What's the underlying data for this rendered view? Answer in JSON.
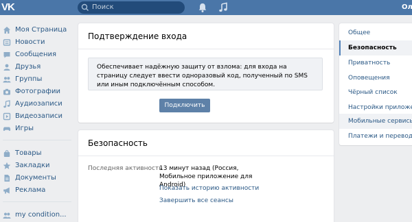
{
  "header": {
    "logo": "VK",
    "search_placeholder": "Поиск",
    "user_name": "Ол"
  },
  "leftnav": {
    "items": [
      {
        "label": "Моя Страница",
        "icon": "home-icon"
      },
      {
        "label": "Новости",
        "icon": "news-icon"
      },
      {
        "label": "Сообщения",
        "icon": "messages-icon"
      },
      {
        "label": "Друзья",
        "icon": "friends-icon"
      },
      {
        "label": "Группы",
        "icon": "groups-icon"
      },
      {
        "label": "Фотографии",
        "icon": "camera-icon"
      },
      {
        "label": "Аудиозаписи",
        "icon": "music-icon"
      },
      {
        "label": "Видеозаписи",
        "icon": "video-icon"
      },
      {
        "label": "Игры",
        "icon": "gamepad-icon"
      },
      {
        "label": "Товары",
        "icon": "bag-icon"
      },
      {
        "label": "Закладки",
        "icon": "star-icon"
      },
      {
        "label": "Документы",
        "icon": "document-icon"
      },
      {
        "label": "Реклама",
        "icon": "megaphone-icon"
      },
      {
        "label": "my condition...",
        "icon": "group-avatar-icon"
      }
    ]
  },
  "login_confirm": {
    "title": "Подтверждение входа",
    "notice": "Обеспечивает надёжную защиту от взлома: для входа на страницу следует ввести одноразовый код, полученный по SMS или иным подключённым способом.",
    "button": "Подключить"
  },
  "security": {
    "title": "Безопасность",
    "last_activity_label": "Последняя активность",
    "last_activity_value": "13 минут назад (Россия, Мобильное приложение для Android)",
    "show_history_link": "Показать историю активности",
    "end_sessions_link": "Завершить все сеансы"
  },
  "settings_menu": {
    "items": [
      {
        "label": "Общее",
        "state": "normal"
      },
      {
        "label": "Безопасность",
        "state": "active"
      },
      {
        "label": "Приватность",
        "state": "normal"
      },
      {
        "label": "Оповещения",
        "state": "normal"
      },
      {
        "label": "Чёрный список",
        "state": "normal"
      },
      {
        "label": "Настройки приложений",
        "state": "normal"
      },
      {
        "label": "Мобильные сервисы",
        "state": "hover"
      },
      {
        "label": "Платежи и переводы",
        "state": "normal"
      }
    ]
  },
  "colors": {
    "header": "#4a76a8",
    "link": "#2a5885",
    "button": "#5e81a8",
    "background": "#edeef0"
  }
}
